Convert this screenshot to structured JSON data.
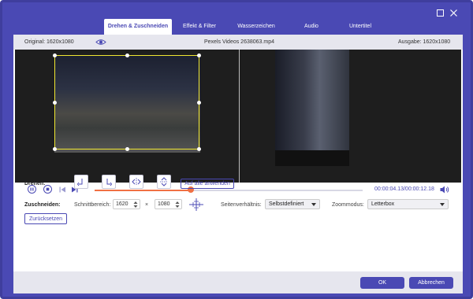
{
  "tabs": [
    {
      "label": "Drehen & Zuschneiden",
      "active": true
    },
    {
      "label": "Effekt & Filter",
      "active": false
    },
    {
      "label": "Wasserzeichen",
      "active": false
    },
    {
      "label": "Audio",
      "active": false
    },
    {
      "label": "Untertitel",
      "active": false
    }
  ],
  "window": {
    "maximize_icon": "maximize-icon",
    "close_icon": "close-icon"
  },
  "infobar": {
    "original": "Original: 1620x1080",
    "filename": "Pexels Videos 2638063.mp4",
    "output": "Ausgabe: 1620x1080"
  },
  "player": {
    "time": "00:00:04.13/00:00:12.18",
    "progress_fraction": 0.36
  },
  "rotate": {
    "label": "Drehen:",
    "apply_all": "Auf alle anwenden"
  },
  "crop": {
    "label": "Zuschneiden:",
    "area_label": "Schnittbereich:",
    "width": "1620",
    "times": "×",
    "height": "1080",
    "aspect_label": "Seitenverhältnis:",
    "aspect_value": "Selbstdefiniert",
    "zoom_label": "Zoommodus:",
    "zoom_value": "Letterbox",
    "reset": "Zurücksetzen"
  },
  "footer": {
    "ok": "OK",
    "cancel": "Abbrechen"
  },
  "colors": {
    "accent": "#4a49b4",
    "progress": "#f07043",
    "crop_frame": "#f1e832"
  }
}
